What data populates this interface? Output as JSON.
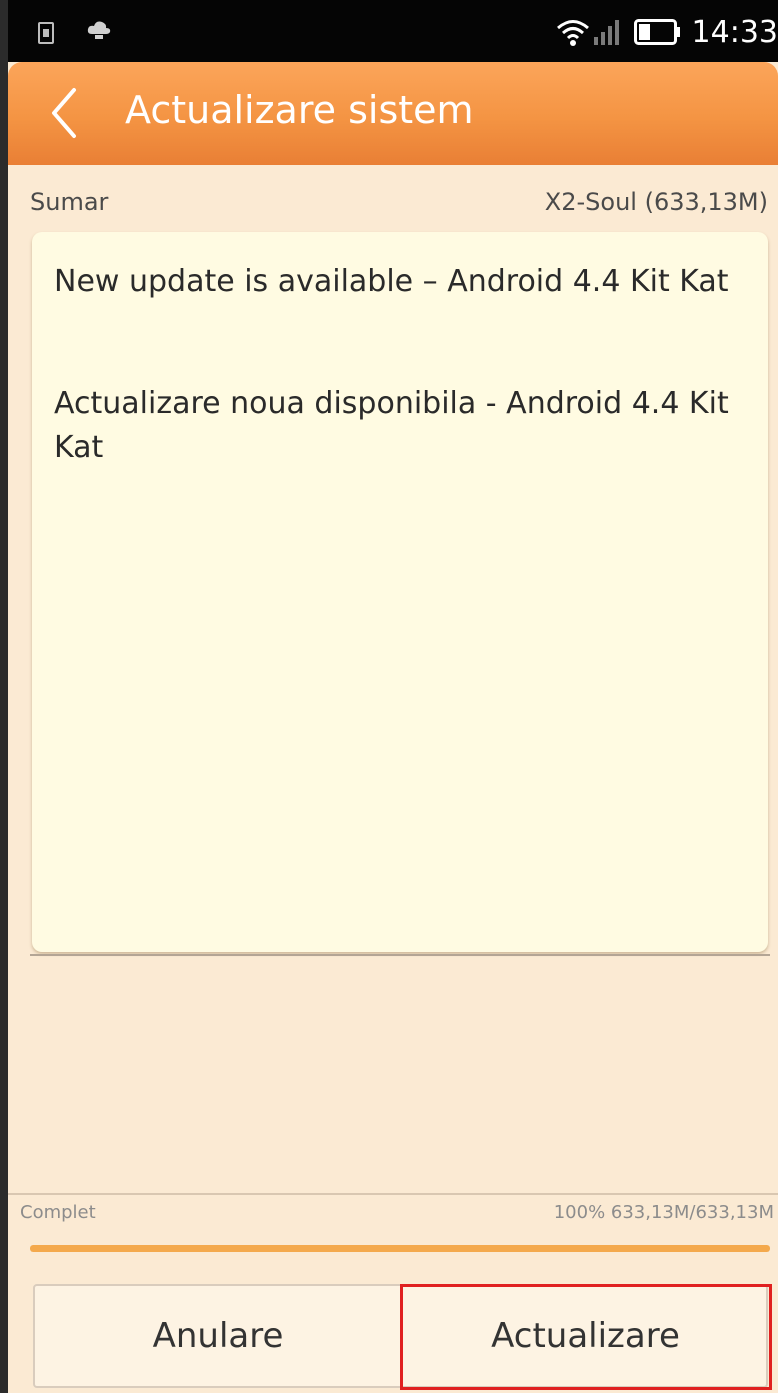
{
  "status_bar": {
    "time": "14:33",
    "icons": [
      "sim-card-icon",
      "cloud-icon",
      "wifi-icon",
      "signal-icon",
      "battery-icon"
    ]
  },
  "app_bar": {
    "back_icon": "back-chevron-icon",
    "title": "Actualizare sistem",
    "accent_color": "#f49443"
  },
  "summary": {
    "label": "Sumar",
    "package_info": "X2-Soul (633,13M)"
  },
  "release_notes": [
    "New update is available – Android 4.4 Kit Kat",
    "Actualizare noua disponibila - Android 4.4 Kit Kat"
  ],
  "download": {
    "status": "Complet",
    "detail": "100% 633,13M/633,13M",
    "progress_fraction": 1.0
  },
  "buttons": {
    "cancel_label": "Anulare",
    "update_label": "Actualizare"
  },
  "colors": {
    "background": "#fbead3",
    "card": "#fffbe2",
    "progress": "#f4a94c",
    "highlight": "#e02020"
  }
}
